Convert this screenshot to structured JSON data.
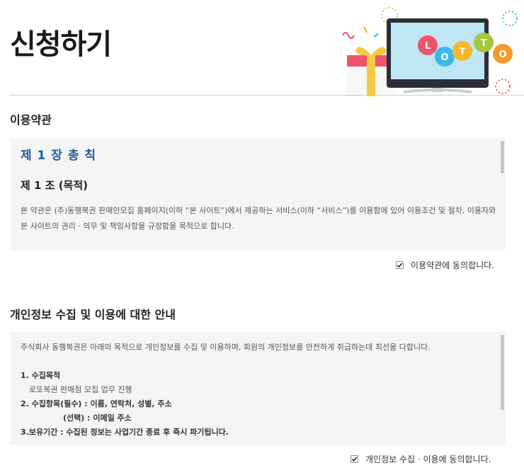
{
  "page": {
    "title": "신청하기"
  },
  "hero": {
    "lotto_letters": [
      "L",
      "O",
      "T",
      "T",
      "O"
    ],
    "ball_colors": [
      "#f0536b",
      "#3ab8ea",
      "#f7b928",
      "#a6c83c",
      "#f29a2e"
    ]
  },
  "terms": {
    "section_title": "이용약관",
    "chapter": "제 1 장 총 칙",
    "article": "제 1 조 (목적)",
    "body": "본 약관은 (주)동행복권 판매인모집 홈페이지(이하 “본 사이트”)에서 제공하는 서비스(이하 “서비스”)를 이용함에 있어 이용조건 및 절차, 이용자와 본 사이트의 권리 · 의무 및 책임사항을 규정함을 목적으로 합니다.",
    "agree_label": "이용약관에 동의합니다.",
    "agree_checked": true
  },
  "privacy": {
    "section_title": "개인정보 수집 및 이용에 대한 안내",
    "intro": "주식회사 동행복권은 아래의 목적으로 개인정보를 수집 및 이용하며, 회원의 개인정보를 안전하게 취급하는데 최선을 다합니다.",
    "item1_title": "1. 수집목적",
    "item1_detail": "로또복권 판매점 모집 업무 진행",
    "item2_title": "2. 수집항목(필수) : 이름, 연락처, 성별, 주소",
    "item2_optional": "(선택) : 이메일 주소",
    "item3_title": "3.보유기간 : 수집된 정보는 사업기간 종료 후 즉시 파기됩니다.",
    "agree_label": "개인정보 수집 · 이용에 동의합니다.",
    "agree_checked": true
  }
}
